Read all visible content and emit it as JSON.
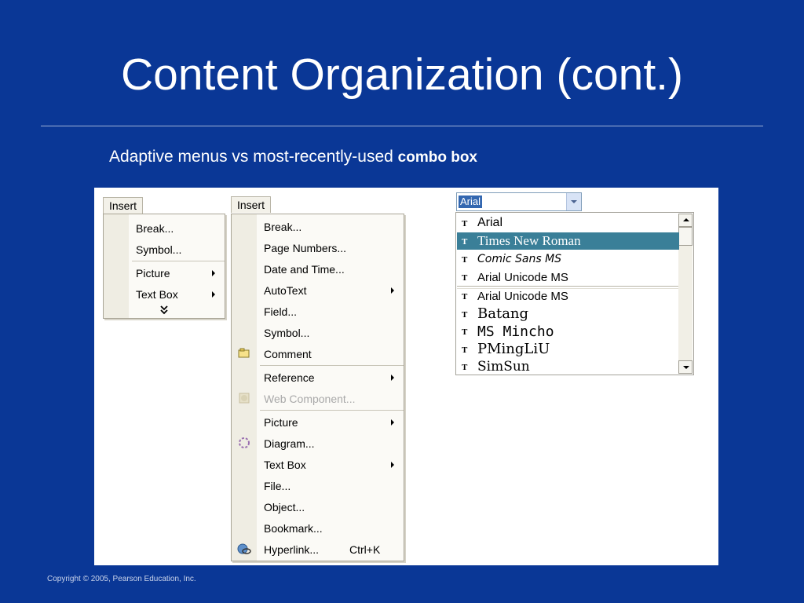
{
  "slide": {
    "title": "Content Organization (cont.)",
    "subtitle_prefix": "Adaptive menus vs most-recently-used ",
    "subtitle_bold": "combo box",
    "copyright": "Copyright © 2005, Pearson Education, Inc."
  },
  "short_menu": {
    "tab_label": "Insert",
    "items": [
      {
        "label": "Break...",
        "submenu": false
      },
      {
        "label": "Symbol...",
        "submenu": false
      },
      {
        "label": "Picture",
        "submenu": true
      },
      {
        "label": "Text Box",
        "submenu": true
      }
    ],
    "expand_icon": "double-chevron-down-icon"
  },
  "full_menu": {
    "tab_label": "Insert",
    "items": [
      {
        "label": "Break...",
        "submenu": false,
        "icon": ""
      },
      {
        "label": "Page Numbers...",
        "submenu": false,
        "icon": ""
      },
      {
        "label": "Date and Time...",
        "submenu": false,
        "icon": ""
      },
      {
        "label": "AutoText",
        "submenu": true,
        "icon": ""
      },
      {
        "label": "Field...",
        "submenu": false,
        "icon": ""
      },
      {
        "label": "Symbol...",
        "submenu": false,
        "icon": ""
      },
      {
        "label": "Comment",
        "submenu": false,
        "icon": "comment-icon"
      },
      {
        "label": "Reference",
        "submenu": true,
        "icon": ""
      },
      {
        "label": "Web Component...",
        "submenu": false,
        "icon": "web-component-icon",
        "disabled": true
      },
      {
        "label": "Picture",
        "submenu": true,
        "icon": ""
      },
      {
        "label": "Diagram...",
        "submenu": false,
        "icon": "diagram-icon"
      },
      {
        "label": "Text Box",
        "submenu": true,
        "icon": ""
      },
      {
        "label": "File...",
        "submenu": false,
        "icon": ""
      },
      {
        "label": "Object...",
        "submenu": false,
        "icon": ""
      },
      {
        "label": "Bookmark...",
        "submenu": false,
        "icon": ""
      },
      {
        "label": "Hyperlink...",
        "submenu": false,
        "icon": "hyperlink-icon",
        "shortcut": "Ctrl+K"
      }
    ]
  },
  "font_combo": {
    "value": "Arial",
    "mru_fonts": [
      "Arial",
      "Times New Roman",
      "Comic Sans MS",
      "Arial Unicode MS"
    ],
    "all_fonts": [
      "Arial Unicode MS",
      "Batang",
      "MS Mincho",
      "PMingLiU",
      "SimSun"
    ],
    "selected_index": 1,
    "font_type_icon": "truetype-icon",
    "selection_color": "#3a7f98"
  }
}
